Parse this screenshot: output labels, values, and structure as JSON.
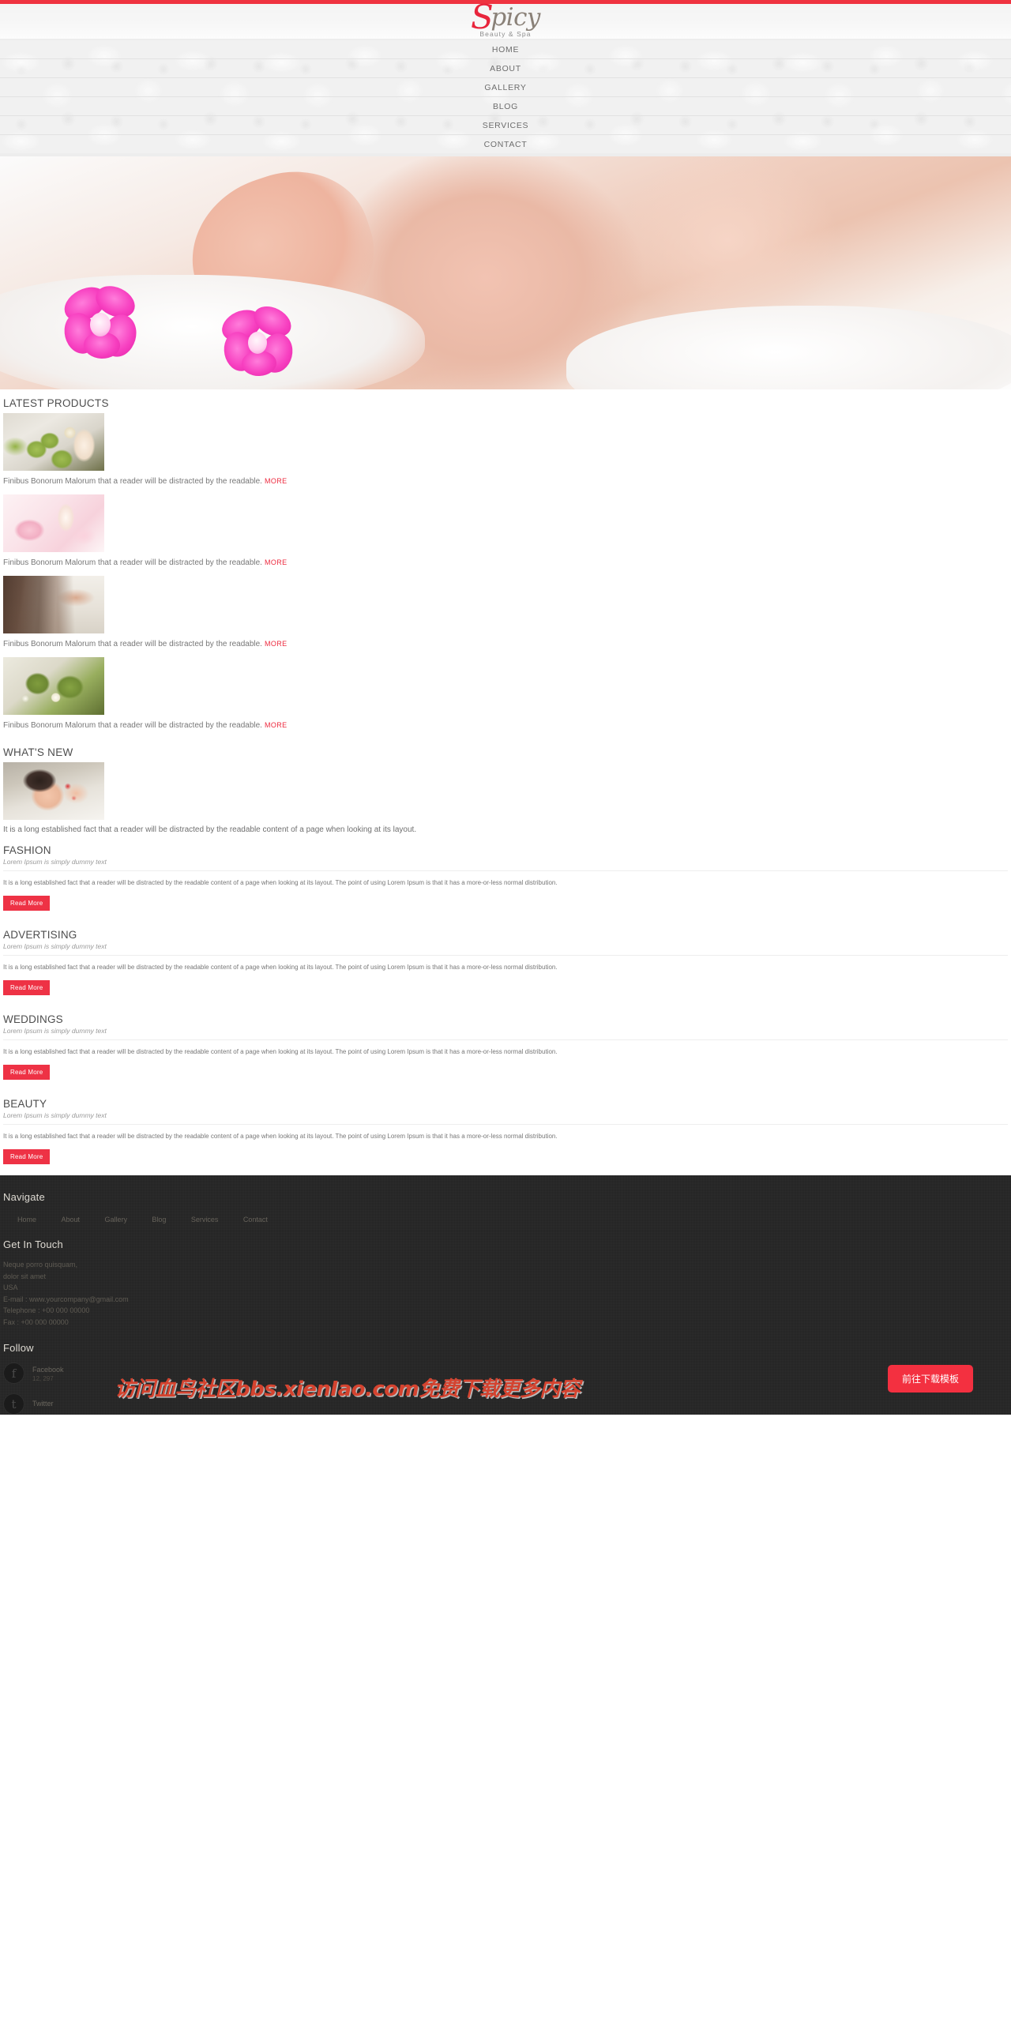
{
  "brand": {
    "logo_initial": "S",
    "logo_rest": "picy",
    "tagline": "Beauty & Spa",
    "accent_color": "#ee3245",
    "logo_red": "#e8253c"
  },
  "nav": {
    "items": [
      {
        "label": "HOME"
      },
      {
        "label": "ABOUT"
      },
      {
        "label": "GALLERY"
      },
      {
        "label": "BLOG"
      },
      {
        "label": "SERVICES"
      },
      {
        "label": "CONTACT"
      }
    ]
  },
  "hero": {
    "alt": "woman receiving facial massage with pink orchids"
  },
  "latest_products": {
    "heading": "LATEST PRODUCTS",
    "items": [
      {
        "image": "spa-candles-green",
        "desc": "Finibus Bonorum Malorum that a reader will be distracted by the readable.",
        "more_label": "MORE"
      },
      {
        "image": "pink-spa-flowers",
        "desc": "Finibus Bonorum Malorum that a reader will be distracted by the readable.",
        "more_label": "MORE"
      },
      {
        "image": "makeup-brushes",
        "desc": "Finibus Bonorum Malorum that a reader will be distracted by the readable.",
        "more_label": "MORE"
      },
      {
        "image": "green-spa-stones",
        "desc": "Finibus Bonorum Malorum that a reader will be distracted by the readable.",
        "more_label": "MORE"
      }
    ]
  },
  "whats_new": {
    "heading": "WHAT'S NEW",
    "image": "woman-massage",
    "desc": "It is a long established fact that a reader will be distracted by the readable content of a page when looking at its layout."
  },
  "blog": {
    "posts": [
      {
        "title": "FASHION",
        "subtitle": "Lorem Ipsum is simply dummy text",
        "body": "It is a long established fact that a reader will be distracted by the readable content of a page when looking at its layout. The point of using Lorem Ipsum is that it has a more-or-less normal distribution.",
        "button": "Read More"
      },
      {
        "title": "ADVERTISING",
        "subtitle": "Lorem Ipsum is simply dummy text",
        "body": "It is a long established fact that a reader will be distracted by the readable content of a page when looking at its layout. The point of using Lorem Ipsum is that it has a more-or-less normal distribution.",
        "button": "Read More"
      },
      {
        "title": "WEDDINGS",
        "subtitle": "Lorem Ipsum is simply dummy text",
        "body": "It is a long established fact that a reader will be distracted by the readable content of a page when looking at its layout. The point of using Lorem Ipsum is that it has a more-or-less normal distribution.",
        "button": "Read More"
      },
      {
        "title": "BEAUTY",
        "subtitle": "Lorem Ipsum is simply dummy text",
        "body": "It is a long established fact that a reader will be distracted by the readable content of a page when looking at its layout. The point of using Lorem Ipsum is that it has a more-or-less normal distribution.",
        "button": "Read More"
      }
    ]
  },
  "footer": {
    "navigate_heading": "Navigate",
    "navigate_links": [
      {
        "label": "Home"
      },
      {
        "label": "About"
      },
      {
        "label": "Gallery"
      },
      {
        "label": "Blog"
      },
      {
        "label": "Services"
      },
      {
        "label": "Contact"
      }
    ],
    "contact_heading": "Get In Touch",
    "address_line1": "Neque porro quisquam,",
    "address_line2": "dolor sit amet",
    "address_line3": "USA",
    "email_line": "E-mail : www.yourcompany@gmail.com",
    "telephone_line": "Telephone : +00 000 00000",
    "fax_line": "Fax : +00 000 00000",
    "follow_heading": "Follow",
    "social": [
      {
        "icon": "facebook-icon",
        "glyph": "f",
        "name": "Facebook",
        "count": "12, 297"
      },
      {
        "icon": "twitter-icon",
        "glyph": "t",
        "name": "Twitter",
        "count": ""
      }
    ]
  },
  "overlay": {
    "watermark": "访问血鸟社区bbs.xienIao.com免费下载更多内容",
    "download_button": "前往下载模板"
  }
}
